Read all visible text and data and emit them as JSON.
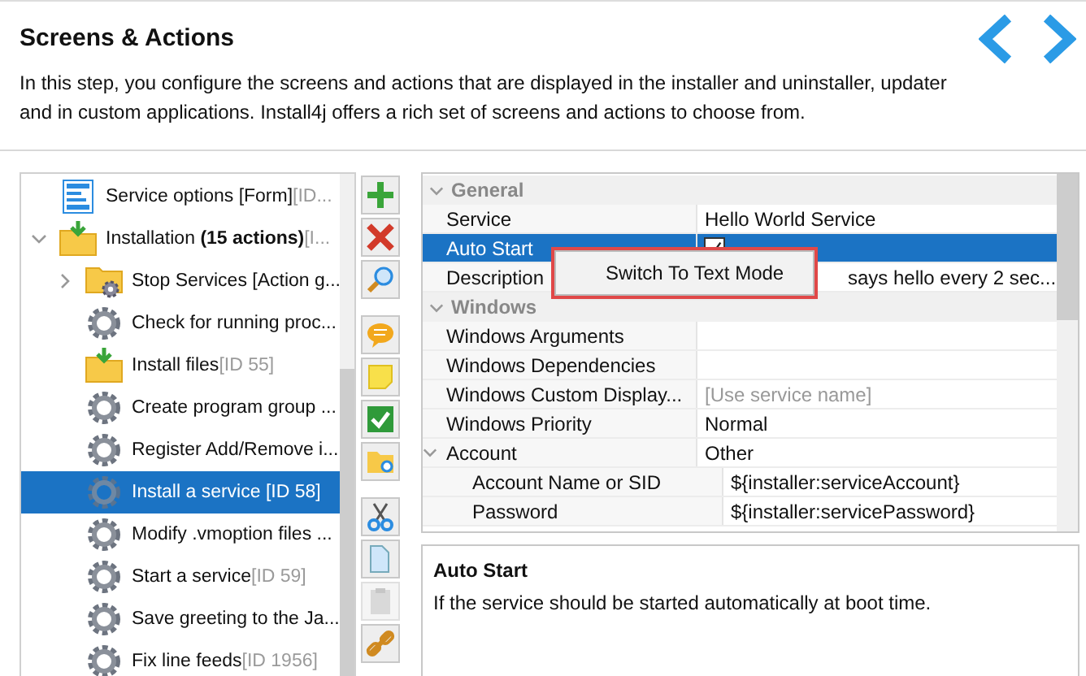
{
  "header": {
    "title": "Screens & Actions",
    "description": "In this step, you configure the screens and actions that are displayed in the installer and uninstaller, updater and in custom applications. Install4j offers a rich set of screens and actions to choose from."
  },
  "tree": [
    {
      "label": "Service options [Form]",
      "suffix": "[ID...",
      "kind": "form",
      "selected": false
    },
    {
      "label": "Installation **(15 actions)**",
      "suffix": "[I...",
      "kind": "folder-download",
      "expanded": true,
      "selected": false,
      "children": [
        {
          "label": "Stop Services [Action g...",
          "kind": "folder-gear",
          "expanded": false,
          "selected": false
        },
        {
          "label": "Check for running proc...",
          "kind": "gear",
          "selected": false
        },
        {
          "label": "Install files",
          "suffix": "[ID 55]",
          "kind": "folder-download",
          "selected": false
        },
        {
          "label": "Create program group ...",
          "kind": "gear",
          "selected": false
        },
        {
          "label": "Register Add/Remove i...",
          "kind": "gear",
          "selected": false
        },
        {
          "label": "Install a service [ID 58]",
          "kind": "gear",
          "selected": true
        },
        {
          "label": "Modify .vmoption files ...",
          "kind": "gear",
          "selected": false
        },
        {
          "label": "Start a service",
          "suffix": "[ID 59]",
          "kind": "gear",
          "selected": false
        },
        {
          "label": "Save greeting to the Ja...",
          "kind": "gear",
          "selected": false
        },
        {
          "label": "Fix line feeds",
          "suffix": "[ID 1956]",
          "kind": "gear",
          "selected": false
        }
      ]
    }
  ],
  "toolbar": [
    [
      {
        "kind": "add",
        "disabled": false
      },
      {
        "kind": "delete",
        "disabled": false
      },
      {
        "kind": "search",
        "disabled": false
      }
    ],
    [
      {
        "kind": "comment",
        "disabled": false
      },
      {
        "kind": "note",
        "disabled": false
      },
      {
        "kind": "check",
        "disabled": false
      },
      {
        "kind": "folder",
        "disabled": false
      }
    ],
    [
      {
        "kind": "cut",
        "disabled": false
      },
      {
        "kind": "copy",
        "disabled": false
      },
      {
        "kind": "paste",
        "disabled": true
      },
      {
        "kind": "link",
        "disabled": false
      }
    ]
  ],
  "properties": [
    {
      "title": "General",
      "expanded": true,
      "rows": [
        {
          "name": "Service",
          "kind": "text",
          "value": "Hello World Service",
          "selected": false
        },
        {
          "name": "Auto Start",
          "kind": "checkbox",
          "checked": true,
          "selected": true
        },
        {
          "name": "Description",
          "kind": "text",
          "value": "says hello every 2 sec...",
          "covered": true,
          "selected": false
        }
      ]
    },
    {
      "title": "Windows",
      "expanded": true,
      "rows": [
        {
          "name": "Windows Arguments",
          "kind": "text",
          "selected": false
        },
        {
          "name": "Windows Dependencies",
          "kind": "text",
          "selected": false
        },
        {
          "name": "Windows Custom Display...",
          "kind": "placeholder",
          "value": "[Use service name]",
          "selected": false
        },
        {
          "name": "Windows Priority",
          "kind": "text",
          "value": "Normal",
          "selected": false
        },
        {
          "name": "Account",
          "kind": "text",
          "value": "Other",
          "expanded": true,
          "selected": false,
          "children": [
            {
              "name": "Account Name or SID",
              "kind": "text",
              "value": "${installer:serviceAccount}",
              "selected": false
            },
            {
              "name": "Password",
              "kind": "text",
              "value": "${installer:servicePassword}",
              "selected": false
            }
          ]
        }
      ]
    }
  ],
  "context_menu": {
    "items": [
      {
        "label": "Switch To Text Mode",
        "highlighted": true
      }
    ]
  },
  "help": {
    "title": "Auto Start",
    "text": "If the service should be started automatically at boot time."
  }
}
